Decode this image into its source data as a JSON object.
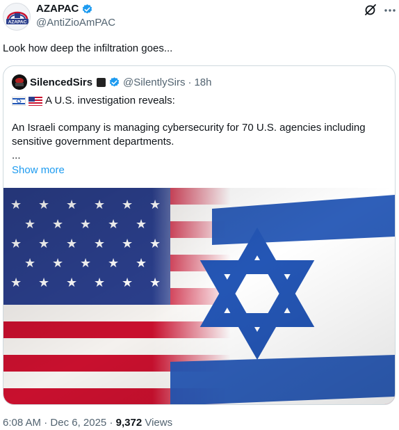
{
  "author": {
    "display_name": "AZAPAC",
    "handle": "@AntiZioAmPAC",
    "avatar_text": "AZAPAC"
  },
  "tweet": {
    "text": "Look how deep the infiltration goes..."
  },
  "quote": {
    "display_name": "SilencedSirs",
    "handle": "@SilentlySirs",
    "separator": "·",
    "time": "18h",
    "first_line": "A U.S. investigation reveals:",
    "body": "An Israeli company is managing cybersecurity for 70 U.S. agencies including sensitive government departments.",
    "ellipsis": "...",
    "show_more": "Show more"
  },
  "footer": {
    "time": "6:08 AM",
    "sep1": "·",
    "date": "Dec 6, 2025",
    "sep2": "·",
    "views_count": "9,372",
    "views_label": "Views"
  },
  "colors": {
    "verified": "#1d9bf0",
    "link": "#1d9bf0",
    "secondary_text": "#536471"
  }
}
